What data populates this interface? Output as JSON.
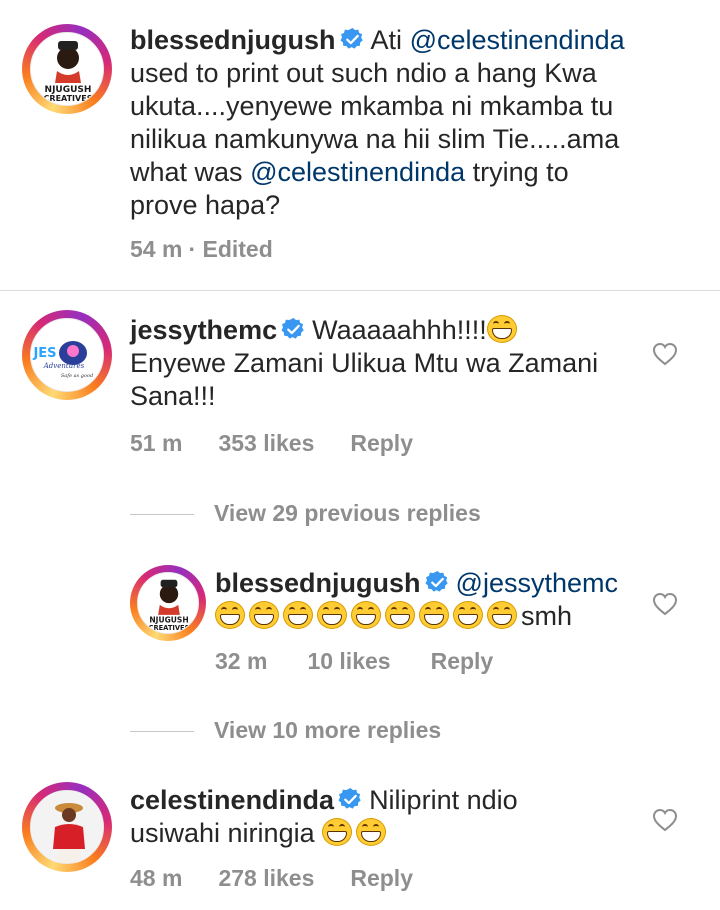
{
  "comments": [
    {
      "username": "blessednjugush",
      "text_lines": [
        "Ati ",
        "@celestinendinda",
        "used to print out such ndio a hang Kwa",
        "ukuta....yenyewe mkamba ni mkamba tu",
        "nilikua namkunywa na hii slim Tie.....ama",
        "what was ",
        "@celestinendinda",
        " trying to",
        "prove hapa?"
      ],
      "time": "54 m",
      "edited": "· Edited",
      "avatar_label": [
        "NJUGUSH",
        "CREATIVES"
      ]
    },
    {
      "username": "jessythemc",
      "text_first": "Waaaaahhh!!!!",
      "text_rest": [
        "Enyewe Zamani Ulikua Mtu wa Zamani",
        "Sana!!!"
      ],
      "time": "51 m",
      "likes": "353 likes",
      "reply": "Reply",
      "avatar_label": [
        "JES",
        "Adventures",
        "Safe as good"
      ]
    },
    {
      "username": "blessednjugush",
      "mention": "@jessythemc",
      "text_end": "smh",
      "time": "32 m",
      "likes": "10 likes",
      "reply": "Reply",
      "avatar_label": [
        "NJUGUSH",
        "CREATIVES"
      ]
    },
    {
      "username": "celestinendinda",
      "text_first": "Niliprint ndio",
      "text_rest": [
        "usiwahi niringia"
      ],
      "time": "48 m",
      "likes": "278 likes",
      "reply": "Reply"
    }
  ],
  "view_previous": "View 29 previous replies",
  "view_more": "View 10 more replies",
  "icons": {
    "verified": "verified-badge-icon",
    "heart": "heart-outline-icon",
    "emoji": "tears-of-joy-emoji"
  },
  "colors": {
    "verified": "#3897f0",
    "mention": "#00376b",
    "meta": "#8e8e8e"
  }
}
